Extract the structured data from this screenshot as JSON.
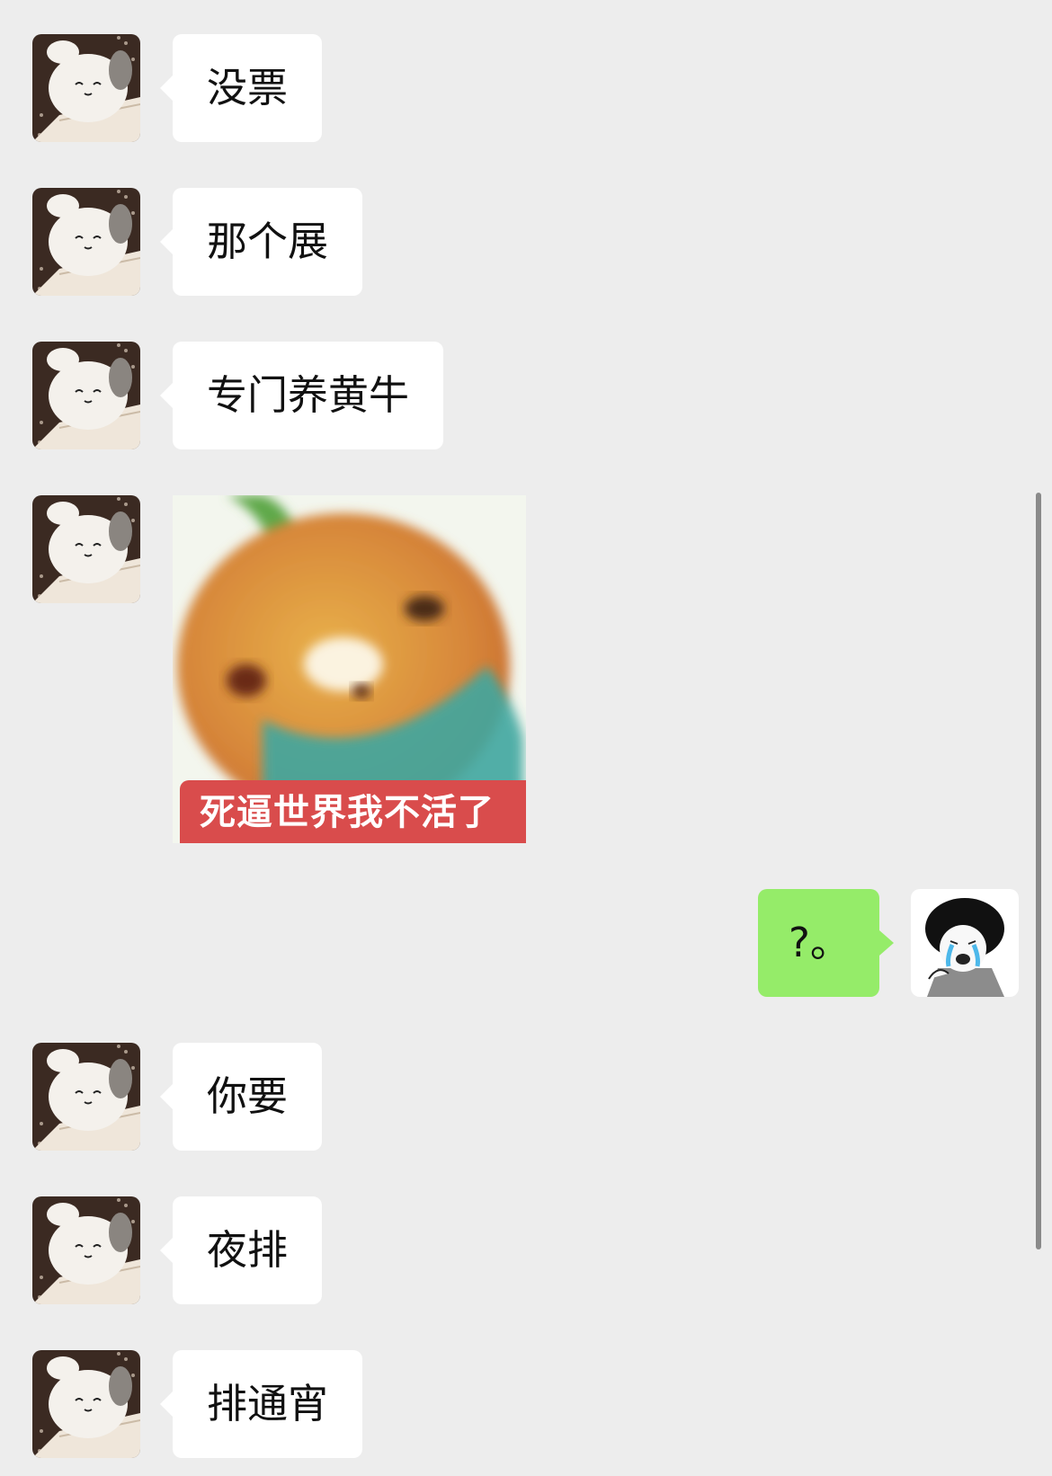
{
  "messages": [
    {
      "side": "in",
      "type": "text",
      "text": "没票"
    },
    {
      "side": "in",
      "type": "text",
      "text": "那个展"
    },
    {
      "side": "in",
      "type": "text",
      "text": "专门养黄牛"
    },
    {
      "side": "in",
      "type": "sticker",
      "caption": "死逼世界我不活了"
    },
    {
      "side": "out",
      "type": "text",
      "text": "?。"
    },
    {
      "side": "in",
      "type": "text",
      "text": "你要"
    },
    {
      "side": "in",
      "type": "text",
      "text": "夜排"
    },
    {
      "side": "in",
      "type": "text",
      "text": "排通宵"
    }
  ],
  "colors": {
    "background": "#ededed",
    "incoming_bubble": "#ffffff",
    "outgoing_bubble": "#95ec69",
    "sticker_caption": "#d94c4c"
  },
  "icons": {
    "contact_avatar": "white-plush-toy-avatar",
    "self_avatar": "crying-cartoon-face-avatar"
  }
}
